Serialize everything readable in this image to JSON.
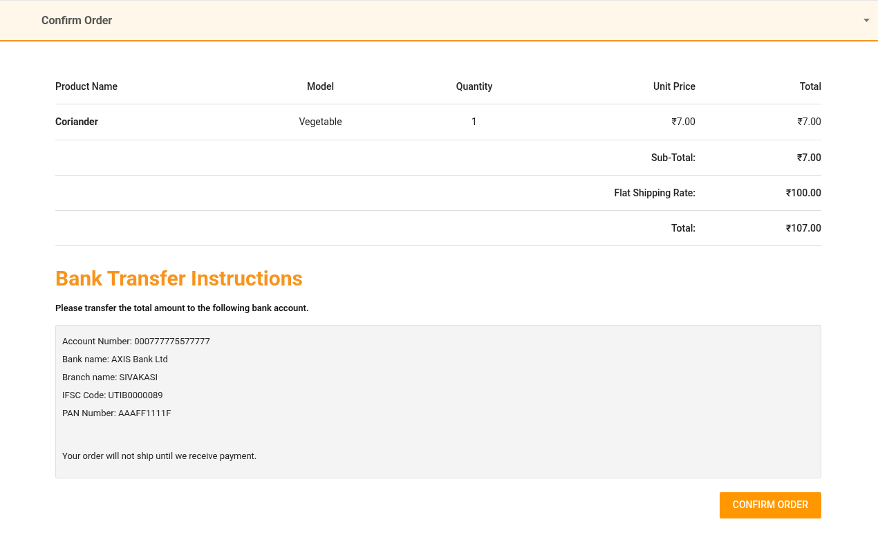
{
  "panel": {
    "title": "Confirm Order",
    "expanded": true
  },
  "table": {
    "columns": [
      "Product Name",
      "Model",
      "Quantity",
      "Unit Price",
      "Total"
    ],
    "rows": [
      {
        "product": "Coriander",
        "model": "Vegetable",
        "quantity": "1",
        "unit_price": "₹7.00",
        "total": "₹7.00"
      }
    ],
    "totals": [
      {
        "label": "Sub-Total:",
        "value": "₹7.00"
      },
      {
        "label": "Flat Shipping Rate:",
        "value": "₹100.00"
      },
      {
        "label": "Total:",
        "value": "₹107.00"
      }
    ]
  },
  "bank_transfer": {
    "heading": "Bank Transfer Instructions",
    "intro": "Please transfer the total amount to the following bank account.",
    "details": [
      "Account Number: 000777775577777",
      "Bank name: AXIS Bank Ltd",
      "Branch name: SIVAKASI",
      "IFSC Code: UTIB0000089",
      "PAN Number: AAAFF1111F"
    ],
    "notice": "Your order will not ship until we receive payment."
  },
  "confirm_button": "CONFIRM ORDER"
}
